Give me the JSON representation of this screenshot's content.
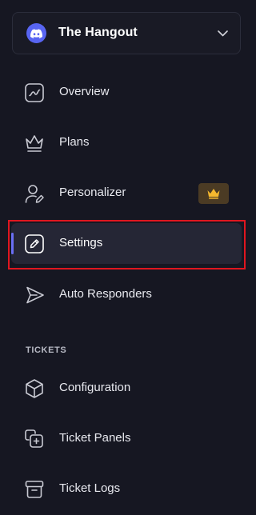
{
  "server": {
    "name": "The Hangout",
    "logo_icon": "discord-icon",
    "dropdown_icon": "chevron-down-icon"
  },
  "nav": {
    "items": [
      {
        "label": "Overview",
        "icon": "activity-chart-icon"
      },
      {
        "label": "Plans",
        "icon": "crown-icon"
      },
      {
        "label": "Personalizer",
        "icon": "user-edit-icon",
        "badge_icon": "crown-icon"
      },
      {
        "label": "Settings",
        "icon": "pencil-icon",
        "active": true
      },
      {
        "label": "Auto Responders",
        "icon": "send-icon"
      }
    ]
  },
  "tickets": {
    "section_title": "TICKETS",
    "items": [
      {
        "label": "Configuration",
        "icon": "cube-icon"
      },
      {
        "label": "Ticket Panels",
        "icon": "add-copy-icon"
      },
      {
        "label": "Ticket Logs",
        "icon": "archive-icon"
      }
    ]
  },
  "colors": {
    "background": "#161722",
    "active_background": "#252635",
    "accent": "#6a6ff5",
    "discord_blurple": "#5865f2",
    "premium_badge": "#4b3b24",
    "premium_crown": "#f5b82e",
    "highlight": "#e0161f"
  }
}
